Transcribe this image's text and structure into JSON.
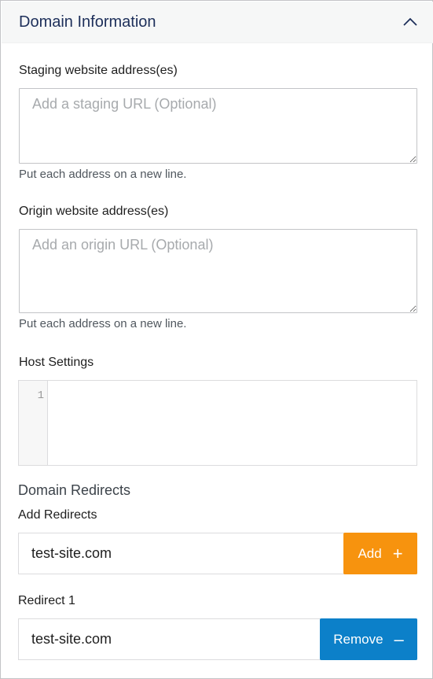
{
  "panel": {
    "title": "Domain Information",
    "collapse_icon": "chevron-up-icon"
  },
  "staging": {
    "label": "Staging website address(es)",
    "placeholder": "Add a staging URL (Optional)",
    "value": "",
    "help": "Put each address on a new line."
  },
  "origin": {
    "label": "Origin website address(es)",
    "placeholder": "Add an origin URL (Optional)",
    "value": "",
    "help": "Put each address on a new line."
  },
  "host_settings": {
    "label": "Host Settings",
    "line_numbers": [
      "1"
    ]
  },
  "redirects": {
    "section_title": "Domain Redirects",
    "add_label": "Add Redirects",
    "add_value": "test-site.com",
    "add_button": "Add",
    "add_icon": "plus-icon",
    "items": [
      {
        "label": "Redirect 1",
        "value": "test-site.com",
        "remove_button": "Remove",
        "remove_icon": "minus-icon"
      }
    ]
  },
  "colors": {
    "add_button": "#f7930e",
    "remove_button": "#0c80c9",
    "title": "#1d2f5a"
  }
}
